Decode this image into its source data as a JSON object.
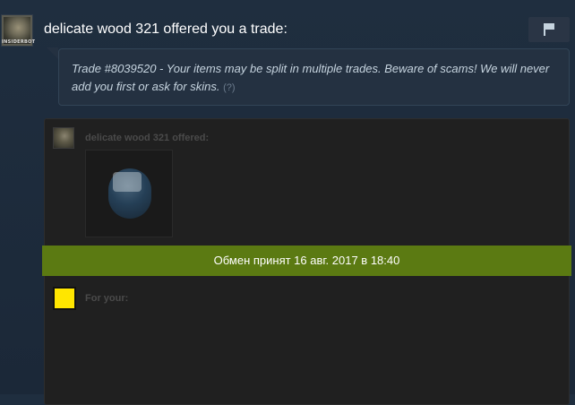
{
  "trade": {
    "header": "delicate wood 321 offered you a trade:",
    "avatar_caption": "INSIDERBOT",
    "message": "Trade #8039520 - Your items may be split in multiple trades. Beware of scams! We will never add you first or ask for skins.",
    "help_link": "(?)",
    "offered_label": "delicate wood 321 offered:",
    "status": "Обмен принят 16 авг. 2017 в 18:40",
    "for_label": "For your:"
  },
  "icons": {
    "report": "flag-icon",
    "item": "case-item-icon"
  },
  "colors": {
    "background": "#1b2838",
    "status_banner": "#5b7a12",
    "recipient_avatar": "#ffe600"
  }
}
